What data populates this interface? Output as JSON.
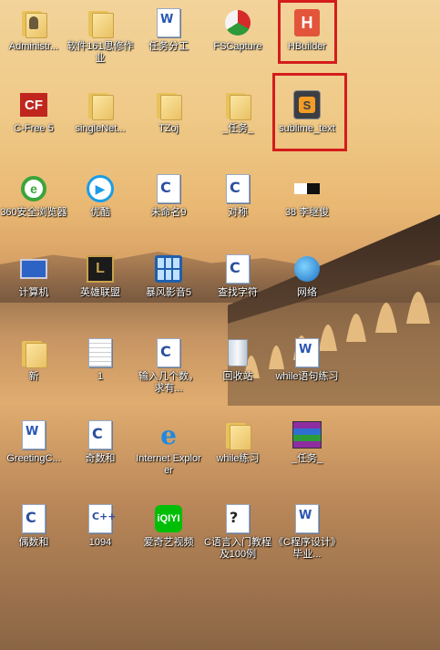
{
  "desktop": {
    "icons": [
      {
        "label": "Administr...",
        "icon": "user-folder-icon"
      },
      {
        "label": "软件161思修作业",
        "icon": "folder-icon"
      },
      {
        "label": "任务分工",
        "icon": "word-document-icon"
      },
      {
        "label": "FSCapture",
        "icon": "fscapture-icon"
      },
      {
        "label": "HBuilder",
        "icon": "hbuilder-icon"
      },
      {
        "label": "C-Free 5",
        "icon": "cfree-icon"
      },
      {
        "label": "singleNet...",
        "icon": "folder-icon"
      },
      {
        "label": "TZoj",
        "icon": "folder-icon"
      },
      {
        "label": "_任务_",
        "icon": "folder-icon"
      },
      {
        "label": "sublime_text",
        "icon": "sublime-text-icon"
      },
      {
        "label": "360安全浏览器",
        "icon": "360-browser-icon"
      },
      {
        "label": "优酷",
        "icon": "youku-icon"
      },
      {
        "label": "未命名9",
        "icon": "c-source-file-icon"
      },
      {
        "label": "对称",
        "icon": "c-source-file-icon"
      },
      {
        "label": "38 李继俊",
        "icon": "image-file-icon"
      },
      {
        "label": "计算机",
        "icon": "computer-icon"
      },
      {
        "label": "英雄联盟",
        "icon": "league-of-legends-icon"
      },
      {
        "label": "暴风影音5",
        "icon": "baofeng-player-icon"
      },
      {
        "label": "查找字符",
        "icon": "c-source-file-icon"
      },
      {
        "label": "网络",
        "icon": "network-icon"
      },
      {
        "label": "新",
        "icon": "folder-icon"
      },
      {
        "label": "1",
        "icon": "text-file-icon"
      },
      {
        "label": "输入几个数，求有...",
        "icon": "c-source-file-icon"
      },
      {
        "label": "回收站",
        "icon": "recycle-bin-icon"
      },
      {
        "label": "while语句练习",
        "icon": "word-document-icon"
      },
      {
        "label": "GreetingC...",
        "icon": "word-document-icon"
      },
      {
        "label": "奇数和",
        "icon": "c-source-file-icon"
      },
      {
        "label": "Internet Explorer",
        "icon": "internet-explorer-icon"
      },
      {
        "label": "while练习",
        "icon": "folder-icon"
      },
      {
        "label": "_任务_",
        "icon": "winrar-archive-icon"
      },
      {
        "label": "偶数和",
        "icon": "c-source-file-icon"
      },
      {
        "label": "1094",
        "icon": "cpp-source-file-icon"
      },
      {
        "label": "爱奇艺视频",
        "icon": "iqiyi-icon"
      },
      {
        "label": "C语言入门教程及100例",
        "icon": "help-file-icon"
      },
      {
        "label": "《C程序设计》毕业...",
        "icon": "word-document-icon"
      }
    ]
  }
}
